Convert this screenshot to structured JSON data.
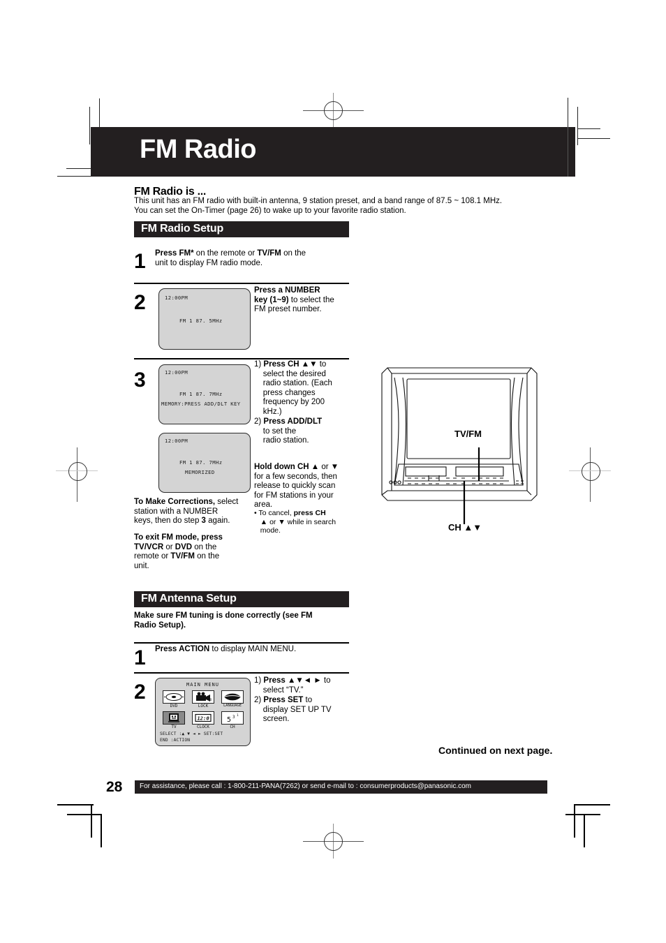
{
  "document": {
    "title": "FM Radio",
    "page_number": "28"
  },
  "intro": {
    "heading": "FM Radio is ...",
    "line1": "This unit has an FM radio with built-in antenna, 9 station preset, and a band range of 87.5 ~ 108.1 MHz.",
    "line2": "You can set the On-Timer (page 26) to wake up to your favorite radio station."
  },
  "fm_radio_setup": {
    "header": "FM Radio Setup",
    "step1": {
      "number": "1",
      "html": "<b>Press FM*</b> on the remote or <b>TV/FM</b> on the<br>unit to display FM radio mode."
    },
    "step2": {
      "number": "2",
      "display": {
        "clock": "12:00PM",
        "status": "FM 1   87. 5MHz"
      },
      "html": "<b>Press a NUMBER<br>key (1~9)</b> to select the<br>FM preset number."
    },
    "step3": {
      "number": "3",
      "display_a": {
        "clock": "12:00PM",
        "status": "FM 1   87. 7MHz",
        "message": "MEMORY:PRESS ADD/DLT KEY"
      },
      "display_b": {
        "clock": "12:00PM",
        "status": "FM 1   87. 7MHz",
        "message": "MEMORIZED"
      },
      "item1_html": "1) <b>Press CH ▲▼</b> to<br>&nbsp;&nbsp;&nbsp;&nbsp;select the desired<br>&nbsp;&nbsp;&nbsp;&nbsp;radio station. (Each<br>&nbsp;&nbsp;&nbsp;&nbsp;press changes<br>&nbsp;&nbsp;&nbsp;&nbsp;frequency by 200<br>&nbsp;&nbsp;&nbsp;&nbsp;kHz.)",
      "item2_html": "2) <b>Press ADD/DLT</b><br>&nbsp;&nbsp;&nbsp;&nbsp;to set the<br>&nbsp;&nbsp;&nbsp;&nbsp;radio station.",
      "hold_html": "<b>Hold down CH ▲</b> or <b>▼</b><br>for a few seconds, then<br>release to quickly scan<br>for FM stations in your<br>area.",
      "cancel_html": "• To cancel, <b>press CH</b><br>&nbsp;&nbsp;&nbsp;<b>▲</b> or <b>▼</b> while in search<br>&nbsp;&nbsp;&nbsp;mode."
    },
    "corrections_html": "<b>To Make Corrections,</b> select<br>station with a NUMBER<br>keys, then do step <b>3</b> again.",
    "exit_html": "<b>To exit FM mode, press<br>TV/VCR</b> or <b>DVD</b> on the<br>remote or <b>TV/FM</b> on the<br>unit."
  },
  "fm_antenna_setup": {
    "header": "FM Antenna Setup",
    "note_html": "<b>Make sure FM tuning is done correctly (see FM<br>Radio Setup).</b>",
    "step1": {
      "number": "1",
      "html": "<b>Press ACTION</b> to display MAIN MENU."
    },
    "step2": {
      "number": "2",
      "item1_html": "1) <b>Press ▲▼◄ ►</b> to<br>&nbsp;&nbsp;&nbsp;&nbsp;select “TV.”",
      "item2_html": "2) <b>Press SET</b> to<br>&nbsp;&nbsp;&nbsp;&nbsp;display SET UP TV<br>&nbsp;&nbsp;&nbsp;&nbsp;screen."
    }
  },
  "main_menu": {
    "title": "MAIN MENU",
    "items": [
      {
        "label": "DVD",
        "icon": "disc-icon",
        "selected": false
      },
      {
        "label": "LOCK",
        "icon": "camcorder-lock-icon",
        "selected": false
      },
      {
        "label": "LANGUAGE",
        "icon": "mouth-language-icon",
        "selected": false
      },
      {
        "label": "TV",
        "icon": "tv-face-icon",
        "selected": true
      },
      {
        "label": "CLOCK",
        "icon": "clock-icon",
        "selected": false
      },
      {
        "label": "CH",
        "icon": "channel-number-icon",
        "selected": false
      }
    ],
    "footer_select": "SELECT :▲ ▼ ◄ ►   SET:SET",
    "footer_end": "END      :ACTION",
    "ch_icon_text": "5",
    "ch_icon_sup1": "3",
    "ch_icon_sup2": "1",
    "clock_icon_text": "12:00"
  },
  "tv_diagram": {
    "label_tvfm": "TV/FM",
    "label_ch": "CH ▲▼"
  },
  "continued": "Continued on next page.",
  "footer": {
    "text": "For assistance, please call : 1-800-211-PANA(7262) or send e-mail to : consumerproducts@panasonic.com"
  },
  "colors": {
    "ink": "#231f20",
    "osd_bg": "#d4d4d4",
    "paper": "#ffffff"
  }
}
